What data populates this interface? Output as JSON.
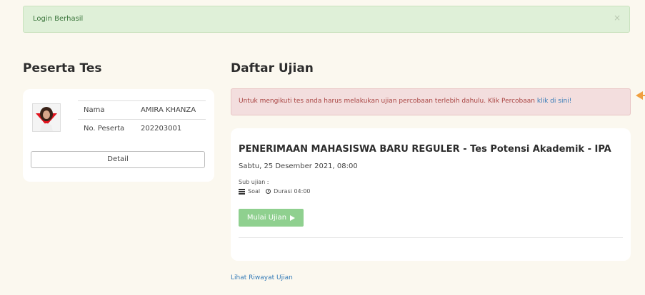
{
  "alert_success": {
    "message": "Login Berhasil",
    "close": "×"
  },
  "left": {
    "heading": "Peserta Tes",
    "participant": {
      "fields": [
        {
          "label": "Nama",
          "value": "AMIRA KHANZA"
        },
        {
          "label": "No. Peserta",
          "value": "202203001"
        }
      ],
      "detail_button": "Detail"
    }
  },
  "right": {
    "heading": "Daftar Ujian",
    "alert_danger": {
      "message": "Untuk mengikuti tes anda harus melakukan ujian percobaan terlebih dahulu. Klik Percobaan",
      "link": "klik di sini!"
    },
    "exam": {
      "title": "PENERIMAAN MAHASISWA BARU REGULER - Tes Potensi Akademik - IPA",
      "date": "Sabtu, 25 Desember 2021, 08:00",
      "sub_label": "Sub ujian :",
      "soal_label": "Soal",
      "durasi_label": "Durasi 04:00",
      "start_button": "Mulai Ujian"
    },
    "history_link": "Lihat Riwayat Ujian"
  },
  "colors": {
    "success_bg": "#dff0d8",
    "danger_bg": "#f3dede",
    "start_button": "#8fd08f",
    "link": "#337ab7",
    "page_bg": "#fbf8ef"
  },
  "icons": [
    "close-icon",
    "avatar-photo",
    "list-icon",
    "clock-icon",
    "play-icon",
    "orange-arrow-icon"
  ]
}
